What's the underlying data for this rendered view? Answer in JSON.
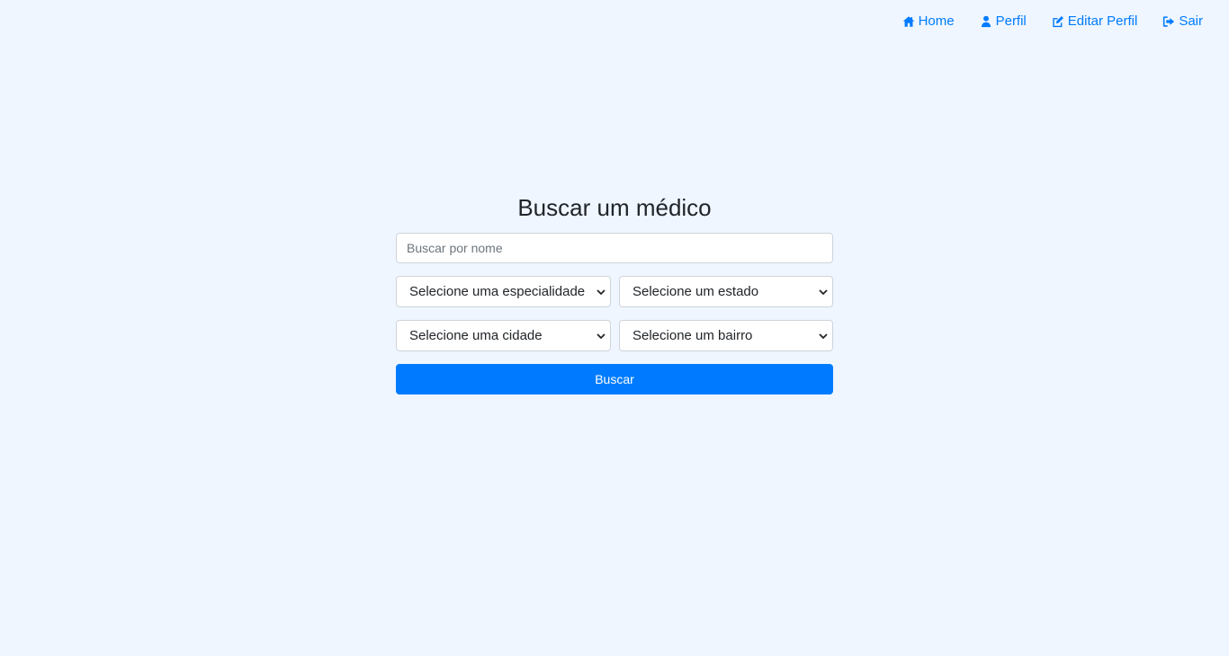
{
  "nav": {
    "items": [
      {
        "label": "Home",
        "icon": "home-icon"
      },
      {
        "label": "Perfil",
        "icon": "user-icon"
      },
      {
        "label": "Editar Perfil",
        "icon": "edit-icon"
      },
      {
        "label": "Sair",
        "icon": "sign-out-icon"
      }
    ]
  },
  "search": {
    "title": "Buscar um médico",
    "name_placeholder": "Buscar por nome",
    "name_value": "",
    "specialty_select": "Selecione uma especialidade",
    "state_select": "Selecione um estado",
    "city_select": "Selecione uma cidade",
    "neighborhood_select": "Selecione um bairro",
    "submit_label": "Buscar"
  },
  "colors": {
    "background": "#eff6ff",
    "accent": "#007bff",
    "button_text": "#ffffff"
  }
}
